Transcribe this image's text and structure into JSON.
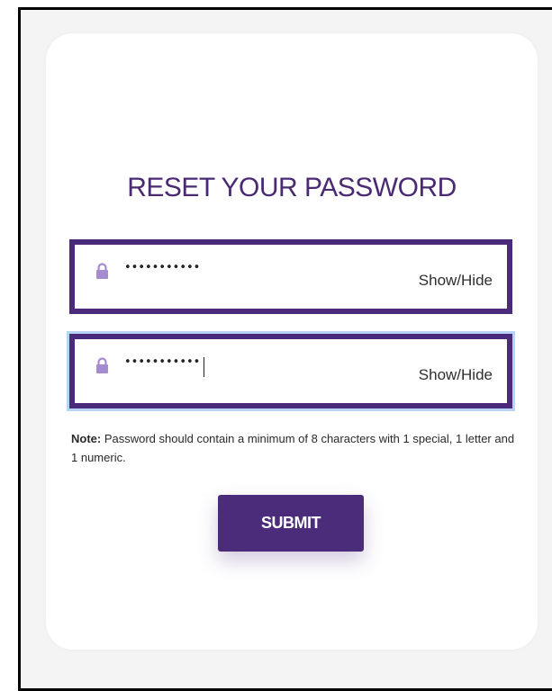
{
  "form": {
    "title": "RESET YOUR PASSWORD",
    "password_field": {
      "value": "•••••••••••",
      "toggle_label": "Show/Hide"
    },
    "confirm_password_field": {
      "value": "•••••••••••",
      "toggle_label": "Show/Hide"
    },
    "note_label": "Note:",
    "note_text": " Password should contain a minimum of 8 characters with 1 special, 1 letter and 1 numeric.",
    "submit_label": "SUBMIT"
  },
  "colors": {
    "brand_purple": "#4b2a7b",
    "lock_icon": "#a58bd0",
    "focus_ring": "#b9d3f5"
  },
  "icons": {
    "lock": "lock-icon"
  }
}
